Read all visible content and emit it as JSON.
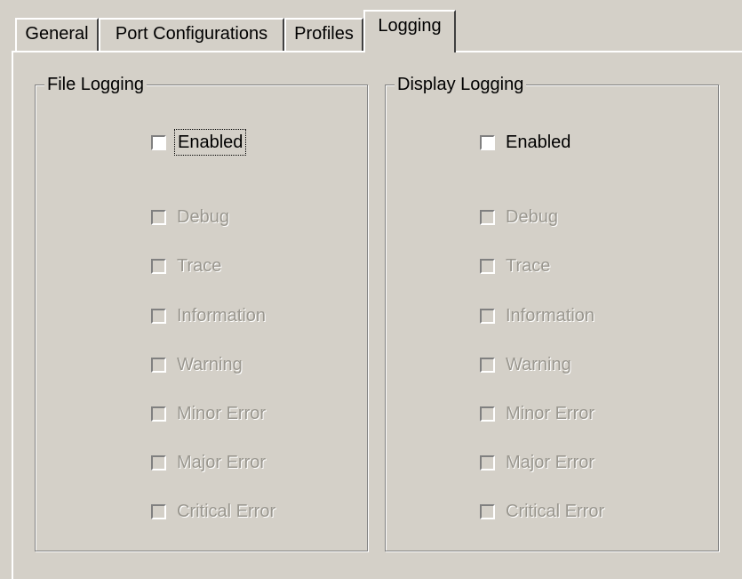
{
  "tabs": [
    {
      "label": "General",
      "active": false
    },
    {
      "label": "Port Configurations",
      "active": false
    },
    {
      "label": "Profiles",
      "active": false
    },
    {
      "label": "Logging",
      "active": true
    }
  ],
  "file_logging": {
    "title": "File Logging",
    "enabled": {
      "label": "Enabled",
      "checked": false,
      "focused": true
    },
    "levels": [
      {
        "label": "Debug",
        "checked": false,
        "disabled": true
      },
      {
        "label": "Trace",
        "checked": false,
        "disabled": true
      },
      {
        "label": "Information",
        "checked": false,
        "disabled": true
      },
      {
        "label": "Warning",
        "checked": false,
        "disabled": true
      },
      {
        "label": "Minor Error",
        "checked": false,
        "disabled": true
      },
      {
        "label": "Major Error",
        "checked": false,
        "disabled": true
      },
      {
        "label": "Critical Error",
        "checked": false,
        "disabled": true
      }
    ]
  },
  "display_logging": {
    "title": "Display Logging",
    "enabled": {
      "label": "Enabled",
      "checked": false,
      "focused": false
    },
    "levels": [
      {
        "label": "Debug",
        "checked": false,
        "disabled": true
      },
      {
        "label": "Trace",
        "checked": false,
        "disabled": true
      },
      {
        "label": "Information",
        "checked": false,
        "disabled": true
      },
      {
        "label": "Warning",
        "checked": false,
        "disabled": true
      },
      {
        "label": "Minor Error",
        "checked": false,
        "disabled": true
      },
      {
        "label": "Major Error",
        "checked": false,
        "disabled": true
      },
      {
        "label": "Critical Error",
        "checked": false,
        "disabled": true
      }
    ]
  },
  "colors": {
    "face": "#d4d0c8",
    "disabled_text": "#9a978f"
  }
}
